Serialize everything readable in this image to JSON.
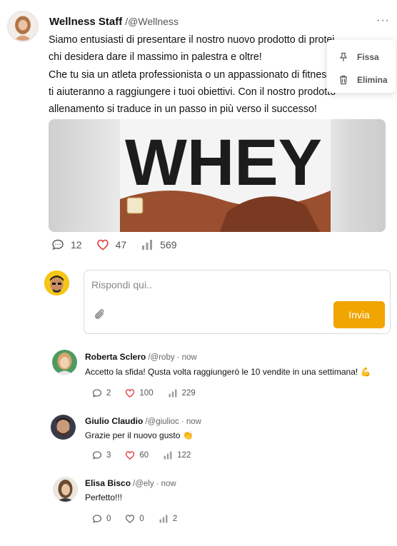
{
  "post": {
    "author_name": "Wellness Staff",
    "author_handle": "/@Wellness",
    "more_label": "···",
    "text": "Siamo entusiasti di presentare il nostro nuovo prodotto di protei\nchi desidera dare il massimo in palestra e oltre!\nChe tu sia un atleta professionista o un appassionato di fitness, q\nti aiuteranno a raggiungere i tuoi obiettivi. Con il nostro prodotto\nallenamento si traduce in un passo in più verso il successo!",
    "image_text": "WHEY",
    "stats": {
      "comments": "12",
      "likes": "47",
      "views": "569"
    }
  },
  "menu": {
    "items": [
      {
        "label": "Fissa",
        "icon": "pin-icon"
      },
      {
        "label": "Elimina",
        "icon": "trash-icon"
      }
    ]
  },
  "reply": {
    "placeholder": "Rispondi qui..",
    "send_label": "Invia"
  },
  "comments": [
    {
      "name": "Roberta Sclero",
      "handle": "/@roby",
      "time": "· now",
      "text": "Accetto la sfida! Qusta volta raggiungerò le 10 vendite in una settimana! 💪",
      "comments": "2",
      "likes": "100",
      "views": "229"
    },
    {
      "name": "Giulio Claudio",
      "handle": "/@giulioc",
      "time": "· now",
      "text": "Grazie per il nuovo gusto 👏",
      "comments": "3",
      "likes": "60",
      "views": "122"
    },
    {
      "name": "Elisa Bisco",
      "handle": "/@ely",
      "time": "· now",
      "text": "Perfetto!!!",
      "comments": "0",
      "likes": "0",
      "views": "2"
    }
  ],
  "colors": {
    "accent": "#f0a500",
    "like": "#d93a3a",
    "muted": "#555555"
  }
}
